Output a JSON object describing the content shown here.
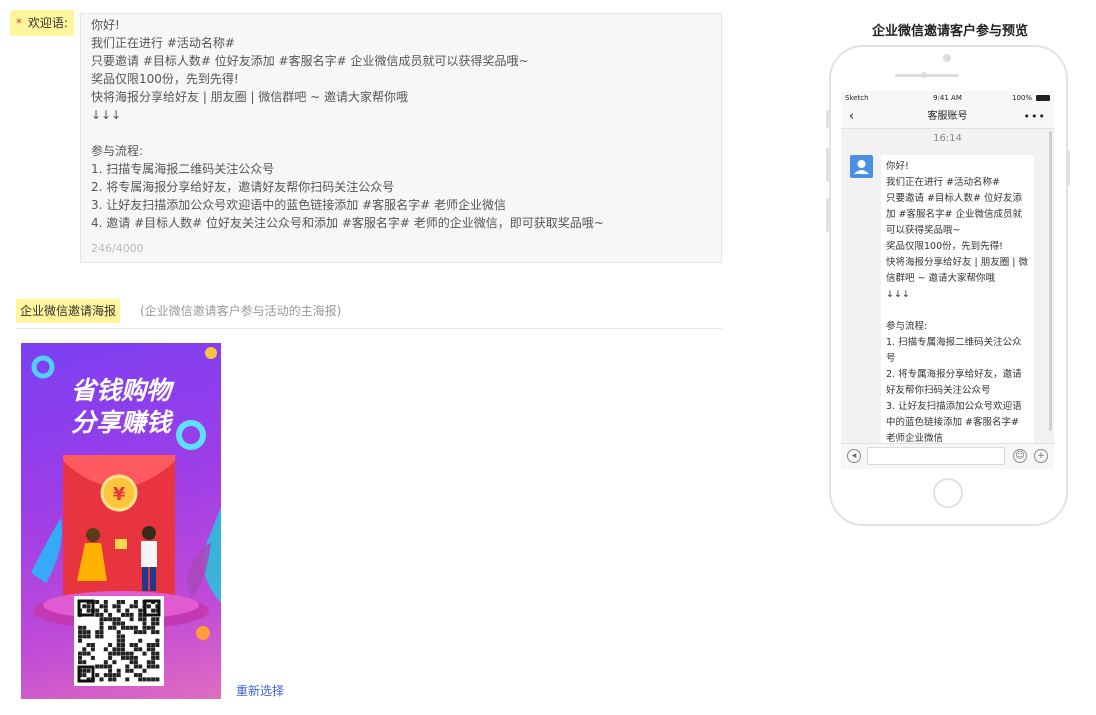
{
  "welcome": {
    "required_mark": "*",
    "label": "欢迎语:",
    "text": "你好!\n我们正在进行 #活动名称#\n只要邀请 #目标人数# 位好友添加 #客服名字# 企业微信成员就可以获得奖品哦~\n奖品仅限100份，先到先得!\n快将海报分享给好友 | 朋友圈 | 微信群吧 ~ 邀请大家帮你哦\n↓↓↓\n\n参与流程:\n1. 扫描专属海报二维码关注公众号\n2. 将专属海报分享给好友，邀请好友帮你扫码关注公众号\n3. 让好友扫描添加公众号欢迎语中的蓝色链接添加 #客服名字# 老师企业微信\n4. 邀请 #目标人数# 位好友关注公众号和添加 #客服名字# 老师的企业微信，即可获取奖品哦~",
    "counter": "246/4000"
  },
  "poster": {
    "label": "企业微信邀请海报",
    "hint": "(企业微信邀请客户参与活动的主海报)",
    "line1": "省钱购物",
    "line2": "分享赚钱",
    "coin_symbol": "¥",
    "reselect": "重新选择"
  },
  "preview": {
    "title": "企业微信邀请客户参与预览",
    "status_carrier": "Sketch",
    "status_time": "9:41 AM",
    "status_battery": "100%",
    "nav_title": "客服账号",
    "chat_time": "16:14",
    "message": "你好!\n我们正在进行 #活动名称#\n只要邀请 #目标人数# 位好友添加 #客服名字# 企业微信成员就可以获得奖品哦~\n奖品仅限100份，先到先得!\n快将海报分享给好友 | 朋友圈 | 微信群吧 ~ 邀请大家帮你哦\n↓↓↓\n\n参与流程:\n1. 扫描专属海报二维码关注公众号\n2. 将专属海报分享给好友，邀请好友帮你扫码关注公众号\n3. 让好友扫描添加公众号欢迎语中的蓝色链接添加 #客服名字# 老师企业微信"
  },
  "icons": {
    "back": "chevron-left-icon",
    "more": "more-icon",
    "voice": "voice-icon",
    "emoji": "emoji-icon",
    "plus": "plus-icon"
  },
  "colors": {
    "highlight": "#fff59d",
    "required": "#e53935",
    "link": "#3b5fd9",
    "avatar": "#4a90e2"
  }
}
